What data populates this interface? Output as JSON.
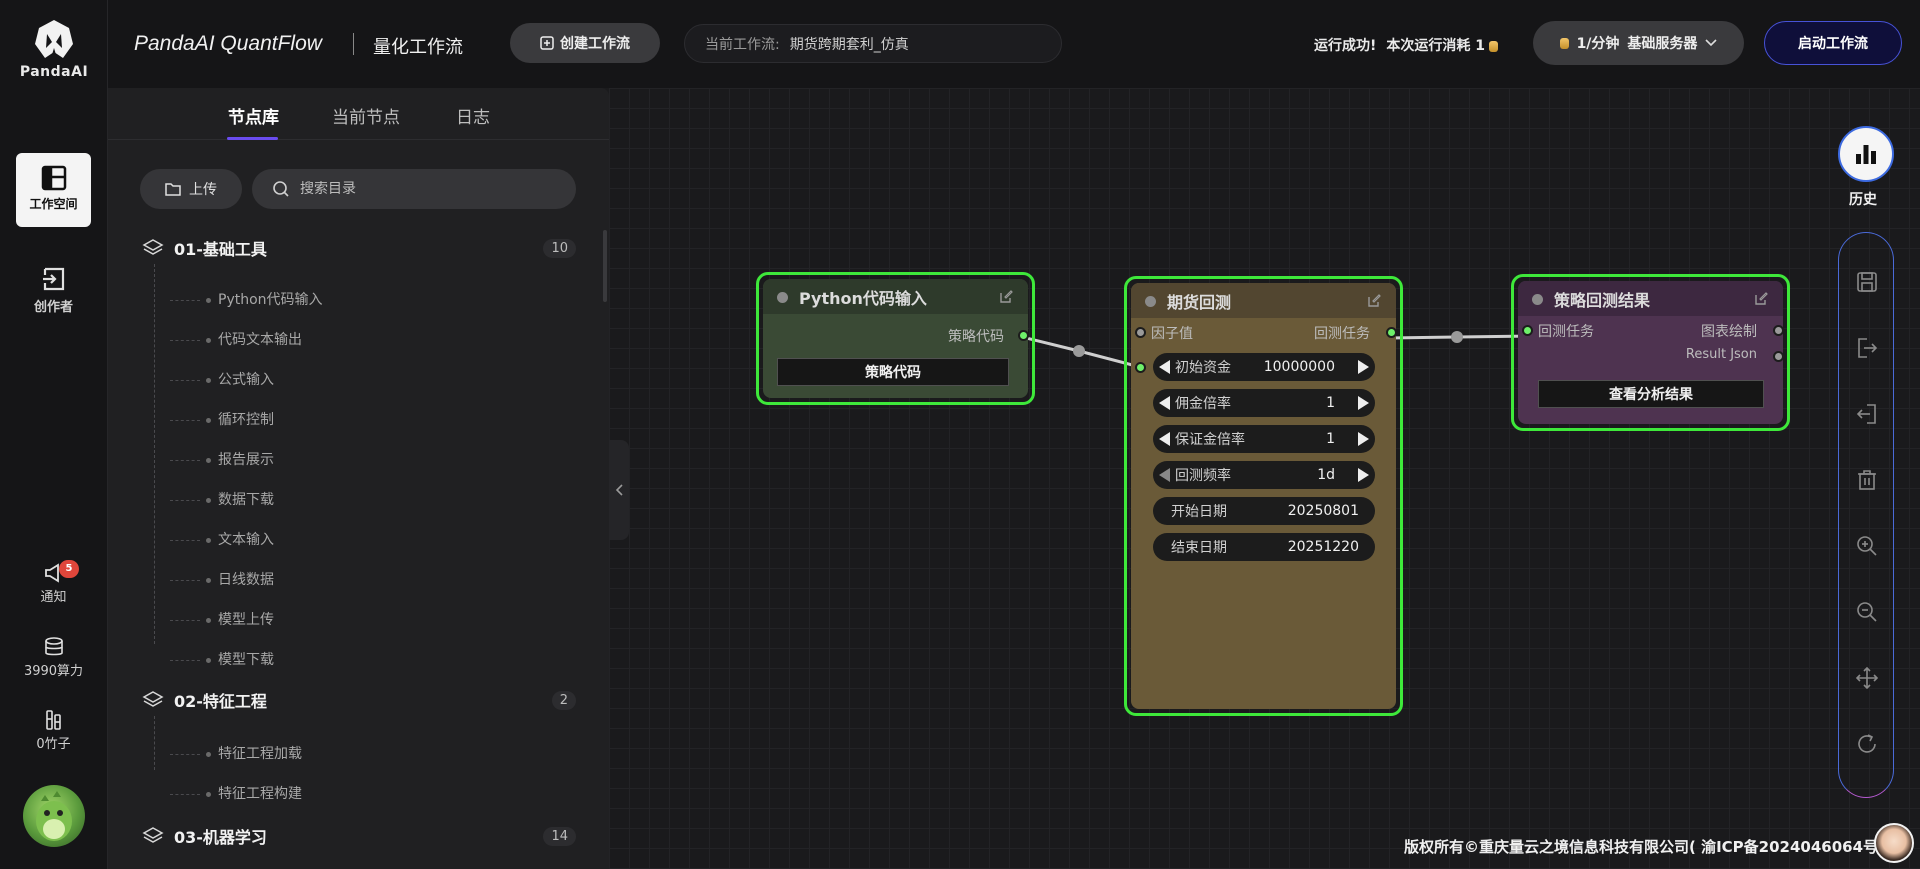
{
  "app": {
    "logo_name": "PandaAI",
    "brand": "PandaAI QuantFlow",
    "subtitle": "量化工作流"
  },
  "rail": {
    "items": [
      {
        "label": "工作空间",
        "icon": "workspace-icon"
      },
      {
        "label": "创作者",
        "icon": "exit-icon"
      }
    ],
    "notify": {
      "label": "通知",
      "badge": "5"
    },
    "compute": {
      "label": "3990算力"
    },
    "bamboo": {
      "label": "0竹子"
    }
  },
  "header": {
    "create_label": "创建工作流",
    "current_label": "当前工作流:",
    "current_value": "期货跨期套利_仿真",
    "run_status": "运行成功!",
    "run_cost": "本次运行消耗 1",
    "rate": "1/分钟",
    "server": "基础服务器",
    "start_label": "启动工作流"
  },
  "panel": {
    "tabs": [
      "节点库",
      "当前节点",
      "日志"
    ],
    "upload_label": "上传",
    "search_placeholder": "搜索目录",
    "categories": [
      {
        "title": "01-基础工具",
        "count": "10",
        "items": [
          "Python代码输入",
          "代码文本输出",
          "公式输入",
          "循环控制",
          "报告展示",
          "数据下载",
          "文本输入",
          "日线数据",
          "模型上传",
          "模型下载"
        ]
      },
      {
        "title": "02-特征工程",
        "count": "2",
        "items": [
          "特征工程加载",
          "特征工程构建"
        ]
      },
      {
        "title": "03-机器学习",
        "count": "14",
        "items": []
      }
    ]
  },
  "nodes": {
    "python": {
      "title": "Python代码输入",
      "out_port": "策略代码",
      "button": "策略代码"
    },
    "backtest": {
      "title": "期货回测",
      "in_port": "因子值",
      "out_port": "回测任务",
      "steppers": [
        {
          "label": "初始资金",
          "value": "10000000"
        },
        {
          "label": "佣金倍率",
          "value": "1"
        },
        {
          "label": "保证金倍率",
          "value": "1"
        },
        {
          "label": "回测频率",
          "value": "1d"
        }
      ],
      "fields": [
        {
          "label": "开始日期",
          "value": "20250801"
        },
        {
          "label": "结束日期",
          "value": "20251220"
        }
      ]
    },
    "result": {
      "title": "策略回测结果",
      "in_port": "回测任务",
      "out_ports": [
        "图表绘制",
        "Result Json"
      ],
      "button": "查看分析结果"
    }
  },
  "tools": {
    "history_label": "历史"
  },
  "footer": {
    "copyright": "版权所有©重庆量云之境信息科技有限公司( 渝ICP备2024046064号"
  },
  "colors": {
    "accent": "#6a4cf0",
    "node_border": "#3ee83a",
    "python_node": "#3a4a35",
    "backtest_node": "#6a5a38",
    "result_node": "#4e3350"
  }
}
